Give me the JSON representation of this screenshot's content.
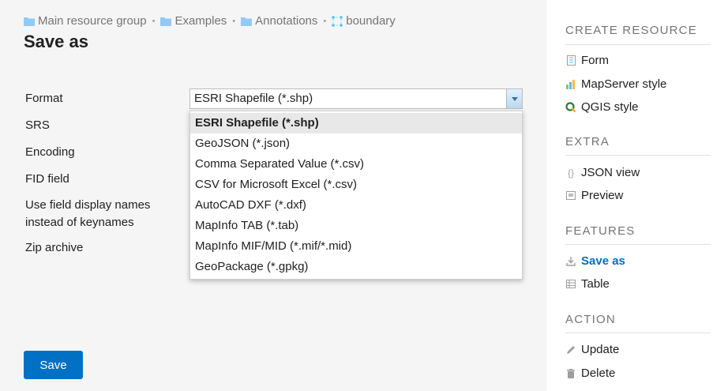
{
  "breadcrumb": {
    "items": [
      {
        "label": "Main resource group",
        "icon": "folder-icon"
      },
      {
        "label": "Examples",
        "icon": "folder-icon"
      },
      {
        "label": "Annotations",
        "icon": "folder-icon"
      },
      {
        "label": "boundary",
        "icon": "vector-layer-icon"
      }
    ],
    "separator": "•"
  },
  "page": {
    "title": "Save as"
  },
  "form": {
    "labels": {
      "format": "Format",
      "srs": "SRS",
      "encoding": "Encoding",
      "fid_field": "FID field",
      "display_names_line1": "Use field display names",
      "display_names_line2": "instead of keynames",
      "zip": "Zip archive"
    },
    "format_value": "ESRI Shapefile (*.shp)",
    "format_options": [
      "ESRI Shapefile (*.shp)",
      "GeoJSON (*.json)",
      "Comma Separated Value (*.csv)",
      "CSV for Microsoft Excel (*.csv)",
      "AutoCAD DXF (*.dxf)",
      "MapInfo TAB (*.tab)",
      "MapInfo MIF/MID (*.mif/*.mid)",
      "GeoPackage (*.gpkg)"
    ],
    "save_label": "Save"
  },
  "sidebar": {
    "create": {
      "title": "CREATE RESOURCE",
      "items": [
        {
          "label": "Form",
          "icon": "form-icon"
        },
        {
          "label": "MapServer style",
          "icon": "mapserver-style-icon"
        },
        {
          "label": "QGIS style",
          "icon": "qgis-style-icon"
        }
      ]
    },
    "extra": {
      "title": "EXTRA",
      "items": [
        {
          "label": "JSON view",
          "icon": "json-icon"
        },
        {
          "label": "Preview",
          "icon": "preview-icon"
        }
      ]
    },
    "features": {
      "title": "FEATURES",
      "items": [
        {
          "label": "Save as",
          "icon": "download-icon"
        },
        {
          "label": "Table",
          "icon": "table-icon"
        }
      ]
    },
    "action": {
      "title": "ACTION",
      "items": [
        {
          "label": "Update",
          "icon": "pencil-icon"
        },
        {
          "label": "Delete",
          "icon": "trash-icon"
        }
      ]
    }
  },
  "colors": {
    "accent": "#0070c5",
    "folder": "#90caf9",
    "muted": "#757575"
  }
}
